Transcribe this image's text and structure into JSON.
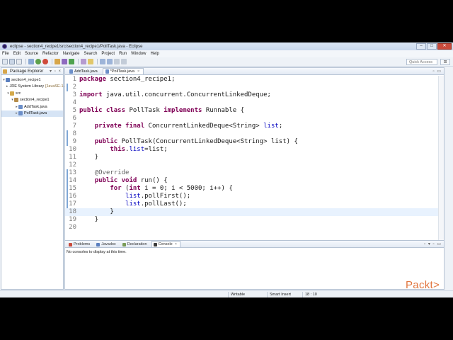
{
  "window": {
    "title": "eclipse - section4_recipe1/src/section4_recipe1/PollTask.java - Eclipse",
    "controls": {
      "minimize": "–",
      "maximize": "□",
      "close": "✕"
    }
  },
  "menubar": {
    "items": [
      "File",
      "Edit",
      "Source",
      "Refactor",
      "Navigate",
      "Search",
      "Project",
      "Run",
      "Window",
      "Help"
    ]
  },
  "toolbar": {
    "quick_access_placeholder": "Quick Access",
    "perspective_icon": "⊞"
  },
  "package_explorer": {
    "title": "Package Explorer",
    "controls": "▾ ▫ ×",
    "tree": [
      {
        "label": "section4_recipe1",
        "twisty": "▾",
        "icon_color": "#5a7fbf",
        "suffix": ""
      },
      {
        "label": "JRE System Library",
        "twisty": "▸",
        "icon_color": "#8d8d8d",
        "suffix": "[JavaSE-1.8]"
      },
      {
        "label": "src",
        "twisty": "▾",
        "icon_color": "#d4a94a",
        "suffix": ""
      },
      {
        "label": "section4_recipe1",
        "twisty": "▾",
        "icon_color": "#b58c4a",
        "suffix": ""
      },
      {
        "label": "AddTask.java",
        "twisty": "▸",
        "icon_color": "#6c8fc9",
        "suffix": ""
      },
      {
        "label": "PollTask.java",
        "twisty": "▸",
        "icon_color": "#6c8fc9",
        "suffix": ""
      }
    ]
  },
  "editor": {
    "tabs": [
      {
        "label": "AddTask.java",
        "active": false
      },
      {
        "label": "*PollTask.java",
        "active": true
      }
    ],
    "tab_close": "×",
    "controls": "▫ ▭",
    "current_line": 18,
    "lines": [
      {
        "n": "1",
        "html": "<span class=\"kw\">package</span> section4_recipe1;"
      },
      {
        "n": "2",
        "html": ""
      },
      {
        "n": "3",
        "html": "<span class=\"kw\">import</span> java.util.concurrent.ConcurrentLinkedDeque;"
      },
      {
        "n": "4",
        "html": ""
      },
      {
        "n": "5",
        "html": "<span class=\"kw\">public class</span> PollTask <span class=\"kw\">implements</span> Runnable {"
      },
      {
        "n": "6",
        "html": ""
      },
      {
        "n": "7",
        "html": "    <span class=\"kw\">private final</span> ConcurrentLinkedDeque&lt;String&gt; <span class=\"fld\">list</span>;"
      },
      {
        "n": "8",
        "html": ""
      },
      {
        "n": "9",
        "html": "    <span class=\"kw\">public</span> PollTask(ConcurrentLinkedDeque&lt;String&gt; list) {"
      },
      {
        "n": "10",
        "html": "        <span class=\"kw\">this</span>.<span class=\"fld\">list</span>=list;"
      },
      {
        "n": "11",
        "html": "    }"
      },
      {
        "n": "12",
        "html": ""
      },
      {
        "n": "13",
        "html": "    <span class=\"ann\">@Override</span>"
      },
      {
        "n": "14",
        "html": "    <span class=\"kw\">public void</span> run() {"
      },
      {
        "n": "15",
        "html": "        <span class=\"kw\">for</span> (<span class=\"kw\">int</span> i = 0; i &lt; 5000; i++) {"
      },
      {
        "n": "16",
        "html": "            <span class=\"fld\">list</span>.pollFirst();"
      },
      {
        "n": "17",
        "html": "            <span class=\"fld\">list</span>.pollLast();"
      },
      {
        "n": "18",
        "html": "        }"
      },
      {
        "n": "19",
        "html": "    }"
      },
      {
        "n": "20",
        "html": ""
      }
    ]
  },
  "console": {
    "tabs": [
      {
        "label": "Problems",
        "icon_color": "#c94b3c",
        "active": false
      },
      {
        "label": "Javadoc",
        "icon_color": "#5a7fbf",
        "active": false
      },
      {
        "label": "Declaration",
        "icon_color": "#7a9b57",
        "active": false
      },
      {
        "label": "Console",
        "icon_color": "#3c3c3c",
        "active": true
      }
    ],
    "tab_close": "×",
    "message": "No consoles to display at this time.",
    "controls": "▫ ▾ ▫ ▭"
  },
  "statusbar": {
    "writable": "Writable",
    "insert_mode": "Smart Insert",
    "position": "18 : 10"
  },
  "branding": {
    "logo_text": "Packt>"
  },
  "colors": {
    "keyword": "#7f0055",
    "field": "#0000c0",
    "annotation": "#646464",
    "brand": "#e1753e"
  }
}
